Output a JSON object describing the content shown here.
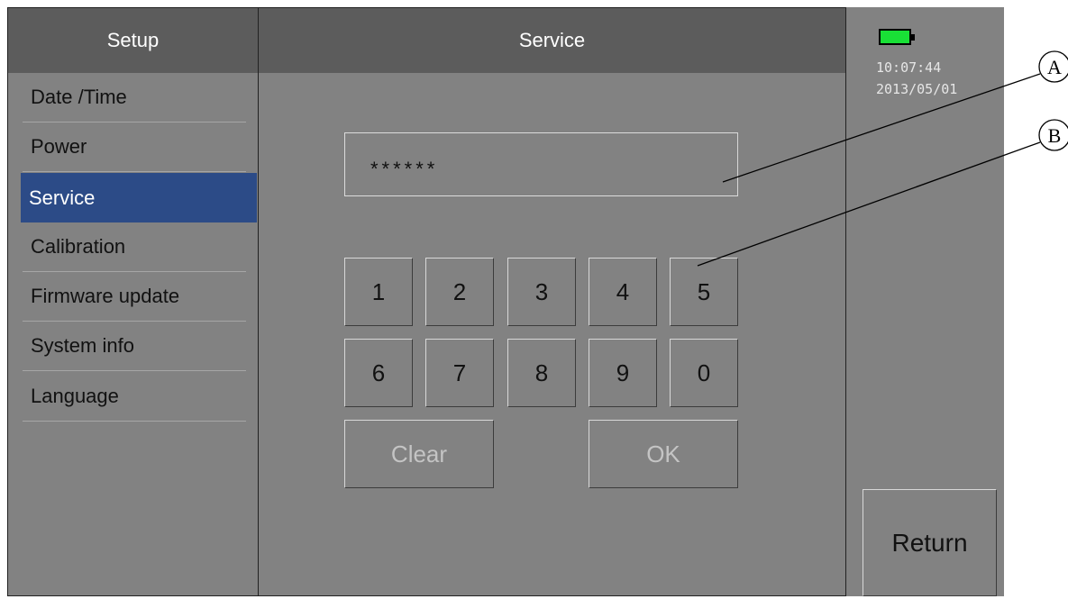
{
  "sidebar": {
    "title": "Setup",
    "items": [
      {
        "label": "Date /Time"
      },
      {
        "label": "Power"
      },
      {
        "label": "Service",
        "selected": true
      },
      {
        "label": "Calibration"
      },
      {
        "label": "Firmware update"
      },
      {
        "label": "System info"
      },
      {
        "label": "Language"
      }
    ]
  },
  "main": {
    "title": "Service",
    "password_value": "******",
    "keypad": {
      "keys": [
        "1",
        "2",
        "3",
        "4",
        "5",
        "6",
        "7",
        "8",
        "9",
        "0"
      ],
      "clear_label": "Clear",
      "ok_label": "OK"
    }
  },
  "status": {
    "time": "10:07:44",
    "date": "2013/05/01",
    "battery_icon": "battery-full-icon",
    "battery_color": "#19e036"
  },
  "return_label": "Return",
  "callouts": {
    "a": "A",
    "b": "B"
  },
  "colors": {
    "selected": "#2c4b87",
    "header": "#5c5c5c",
    "panel": "#828282"
  }
}
